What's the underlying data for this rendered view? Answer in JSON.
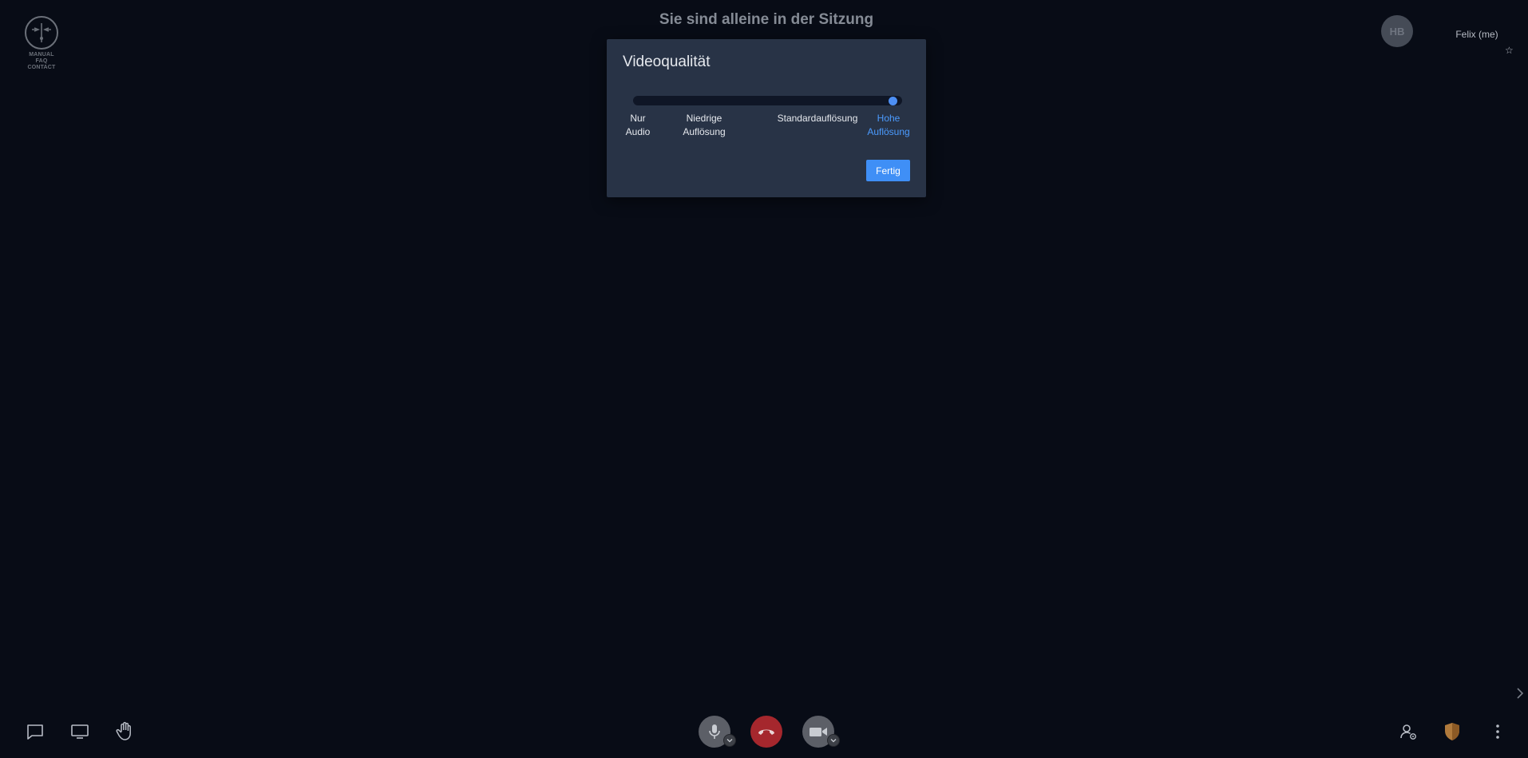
{
  "logo": {
    "lines": [
      "MANUAL",
      "FAQ",
      "CONTACT"
    ]
  },
  "session": {
    "title": "Sie sind alleine in der Sitzung"
  },
  "self_view": {
    "avatar_initials": "HB",
    "name": "Felix (me)",
    "star_glyph": "☆"
  },
  "dialog": {
    "title": "Videoqualität",
    "selected_level": 3,
    "levels": [
      {
        "line1": "Nur",
        "line2": "Audio"
      },
      {
        "line1": "Niedrige",
        "line2": "Auflösung"
      },
      {
        "line1": "Standardauflösung",
        "line2": ""
      },
      {
        "line1": "Hohe",
        "line2": "Auflösung"
      }
    ],
    "done_label": "Fertig"
  },
  "toolbar": {
    "left": [
      "chat-icon",
      "screen-share-icon",
      "raise-hand-icon"
    ],
    "center": [
      "microphone-icon",
      "hangup-icon",
      "camera-icon"
    ],
    "right": [
      "participants-icon",
      "security-shield-icon",
      "more-options-icon"
    ]
  },
  "colors": {
    "background": "#080c16",
    "dialog": "#283346",
    "accent": "#3f8ff6",
    "hangup": "#a5272d",
    "shield": "#b07a3c"
  }
}
